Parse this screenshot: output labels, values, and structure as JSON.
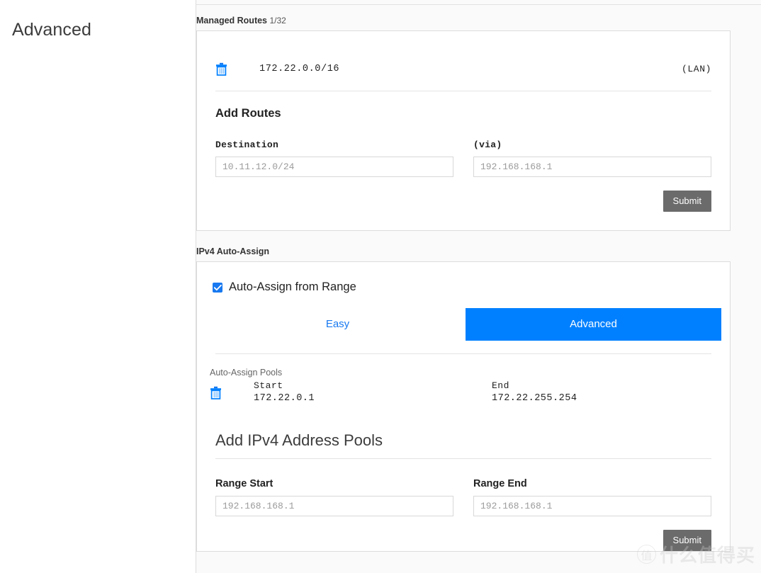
{
  "left_panel": {
    "title": "Advanced"
  },
  "managed_routes": {
    "section_label": "Managed Routes",
    "count": "1/32",
    "rows": [
      {
        "destination": "172.22.0.0/16",
        "interface": "(LAN)",
        "delete_icon": "trash-icon"
      }
    ],
    "add_routes": {
      "title": "Add Routes",
      "destination_label": "Destination",
      "destination_placeholder": "10.11.12.0/24",
      "destination_value": "",
      "via_label": "(via)",
      "via_placeholder": "192.168.168.1",
      "via_value": "",
      "submit_label": "Submit"
    }
  },
  "ipv4_auto_assign": {
    "section_label": "IPv4 Auto-Assign",
    "checkbox": {
      "label": "Auto-Assign from Range",
      "checked": true
    },
    "tabs": [
      {
        "label": "Easy",
        "active": false
      },
      {
        "label": "Advanced",
        "active": true
      }
    ],
    "pools": {
      "heading": "Auto-Assign Pools",
      "col_start_label": "Start",
      "col_end_label": "End",
      "rows": [
        {
          "start": "172.22.0.1",
          "end": "172.22.255.254",
          "delete_icon": "trash-icon"
        }
      ]
    },
    "add_pools": {
      "title": "Add IPv4 Address Pools",
      "range_start_label": "Range Start",
      "range_start_placeholder": "192.168.168.1",
      "range_start_value": "",
      "range_end_label": "Range End",
      "range_end_placeholder": "192.168.168.1",
      "range_end_value": "",
      "submit_label": "Submit"
    }
  },
  "watermark": {
    "logo_char": "值",
    "text": "什么值得买"
  },
  "colors": {
    "accent_blue": "#0080ff",
    "link_blue": "#1879f0",
    "submit_gray": "#6b6b6b",
    "border": "#dcdcdc",
    "page_bg": "#fafafa"
  }
}
